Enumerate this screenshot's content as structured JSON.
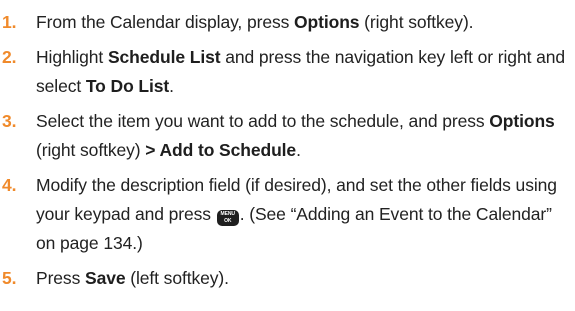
{
  "steps": [
    {
      "num": "1.",
      "parts": [
        {
          "text": "From the Calendar display, press "
        },
        {
          "text": "Options",
          "bold": true
        },
        {
          "text": " (right softkey)."
        }
      ]
    },
    {
      "num": "2.",
      "parts": [
        {
          "text": "Highlight "
        },
        {
          "text": "Schedule List",
          "bold": true
        },
        {
          "text": " and press the navigation key left or right and select "
        },
        {
          "text": "To Do List",
          "bold": true
        },
        {
          "text": "."
        }
      ]
    },
    {
      "num": "3.",
      "parts": [
        {
          "text": "Select the item you want to add to the schedule, and press "
        },
        {
          "text": "Options",
          "bold": true
        },
        {
          "text": " (right softkey) "
        },
        {
          "text": "> Add to Schedule",
          "bold": true
        },
        {
          "text": "."
        }
      ]
    },
    {
      "num": "4.",
      "parts": [
        {
          "text": "Modify the description field (if desired), and set the other fields using your keypad and press "
        },
        {
          "key": "MENU OK"
        },
        {
          "text": ". (See “Adding an Event to the Calendar” on page 134.)"
        }
      ]
    },
    {
      "num": "5.",
      "parts": [
        {
          "text": "Press "
        },
        {
          "text": "Save",
          "bold": true
        },
        {
          "text": " (left softkey)."
        }
      ]
    }
  ]
}
